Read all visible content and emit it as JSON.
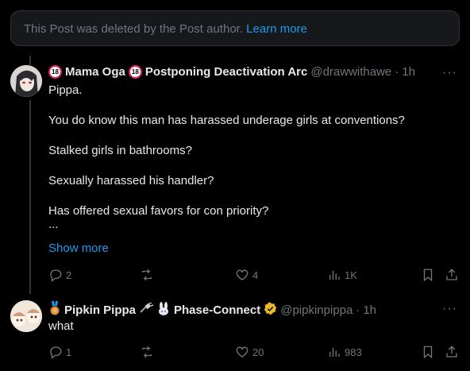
{
  "deleted_notice": {
    "text": "This Post was deleted by the Post author.",
    "link": "Learn more"
  },
  "post1": {
    "display_name": "Mama Oga",
    "display_name_suffix": "Postponing Deactivation Arc",
    "emoji_badge": "18",
    "handle": "@drawwithawe",
    "time": "1h",
    "lines": [
      "Pippa.",
      "You do know this man has harassed underage girls at conventions?",
      "Stalked girls in bathrooms?",
      "Sexually harassed his handler?",
      "Has offered sexual favors for con priority?",
      "..."
    ],
    "show_more": "Show more",
    "stats": {
      "replies": "2",
      "reposts": "",
      "likes": "4",
      "views": "1K"
    }
  },
  "post2": {
    "display_name": "Pipkin Pippa",
    "display_name_suffix": "Phase-Connect",
    "handle": "@pipkinpippa",
    "time": "1h",
    "text": "what",
    "stats": {
      "replies": "1",
      "reposts": "",
      "likes": "20",
      "views": "983"
    }
  },
  "icons": {
    "reply": "reply-icon",
    "repost": "repost-icon",
    "like": "heart-icon",
    "views": "views-icon",
    "bookmark": "bookmark-icon",
    "share": "share-icon",
    "more": "more-dots-icon",
    "verified": "verified-badge-icon",
    "medal": "medal-icon"
  },
  "colors": {
    "background": "#000000",
    "link": "#1d9bf0",
    "muted": "#71767b",
    "text": "#e7e9ea",
    "verified": "#e8b829"
  }
}
